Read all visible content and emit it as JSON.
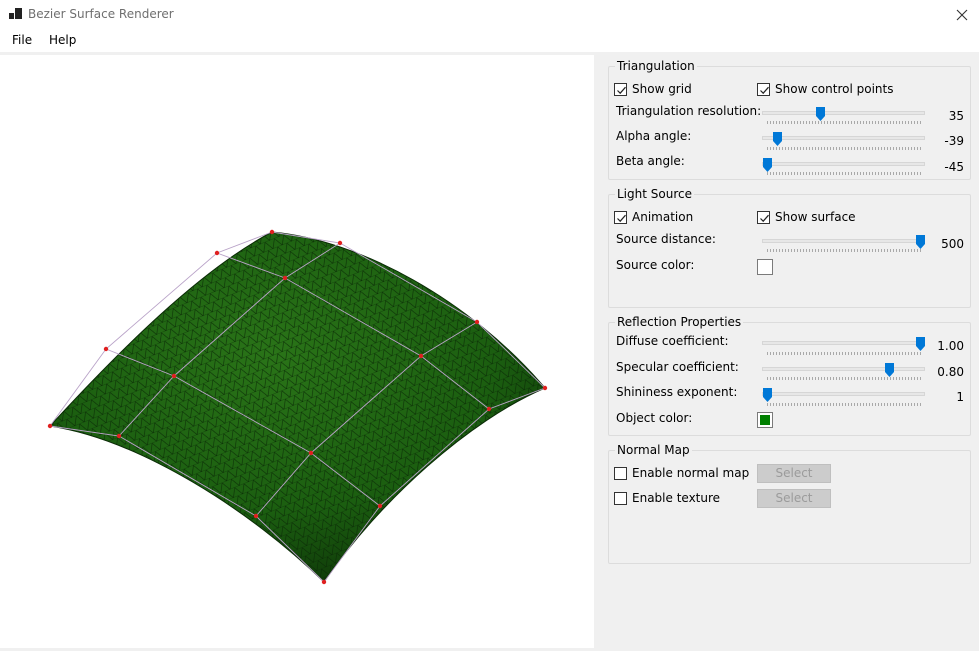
{
  "window": {
    "title": "Bezier Surface Renderer"
  },
  "menu": {
    "file": "File",
    "help": "Help"
  },
  "colors": {
    "surface": "#1b5e10",
    "control_points": "#e02020",
    "object_color": "#008000"
  },
  "triangulation": {
    "title": "Triangulation",
    "show_grid": {
      "label": "Show grid",
      "checked": true
    },
    "show_control_points": {
      "label": "Show control points",
      "checked": true
    },
    "resolution": {
      "label": "Triangulation resolution:",
      "value": "35"
    },
    "alpha": {
      "label": "Alpha angle:",
      "value": "-39"
    },
    "beta": {
      "label": "Beta angle:",
      "value": "-45"
    }
  },
  "light": {
    "title": "Light Source",
    "animation": {
      "label": "Animation",
      "checked": true
    },
    "show_surface": {
      "label": "Show surface",
      "checked": true
    },
    "distance": {
      "label": "Source distance:",
      "value": "500"
    },
    "color": {
      "label": "Source color:",
      "value": "#ffffff"
    }
  },
  "reflection": {
    "title": "Reflection Properties",
    "diffuse": {
      "label": "Diffuse coefficient:",
      "value": "1.00"
    },
    "specular": {
      "label": "Specular coefficient:",
      "value": "0.80"
    },
    "shininess": {
      "label": "Shininess exponent:",
      "value": "1"
    },
    "object_color": {
      "label": "Object color:"
    }
  },
  "normal_map": {
    "title": "Normal Map",
    "enable_normal_map": {
      "label": "Enable normal map",
      "checked": false
    },
    "enable_texture": {
      "label": "Enable texture",
      "checked": false
    },
    "select_label": "Select"
  }
}
